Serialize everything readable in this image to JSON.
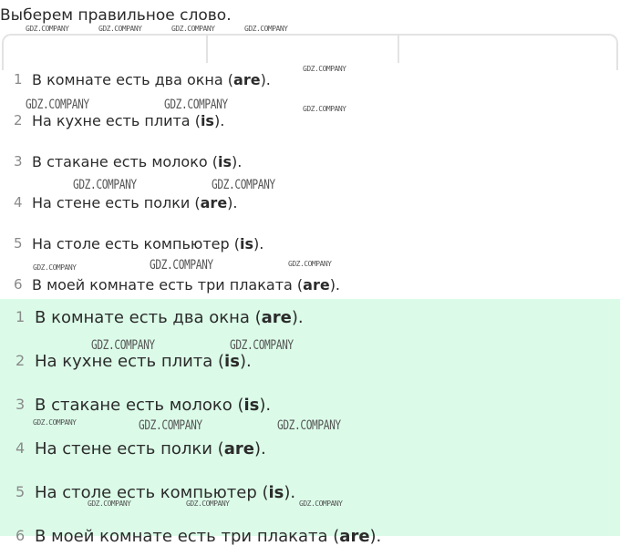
{
  "title": "Выберем правильное слово.",
  "watermark": "GDZ.COMPANY",
  "answers": [
    {
      "num": "1",
      "text": "В комнате есть два окна (",
      "word": "are",
      "end": ")."
    },
    {
      "num": "2",
      "text": "На кухне есть плита (",
      "word": "is",
      "end": ")."
    },
    {
      "num": "3",
      "text": "В стакане есть молоко (",
      "word": "is",
      "end": ")."
    },
    {
      "num": "4",
      "text": "На стене есть полки (",
      "word": "are",
      "end": ")."
    },
    {
      "num": "5",
      "text": "На столе есть компьютер (",
      "word": "is",
      "end": ")."
    },
    {
      "num": "6",
      "text": "В моей комнате есть три плаката (",
      "word": "are",
      "end": ")."
    }
  ]
}
